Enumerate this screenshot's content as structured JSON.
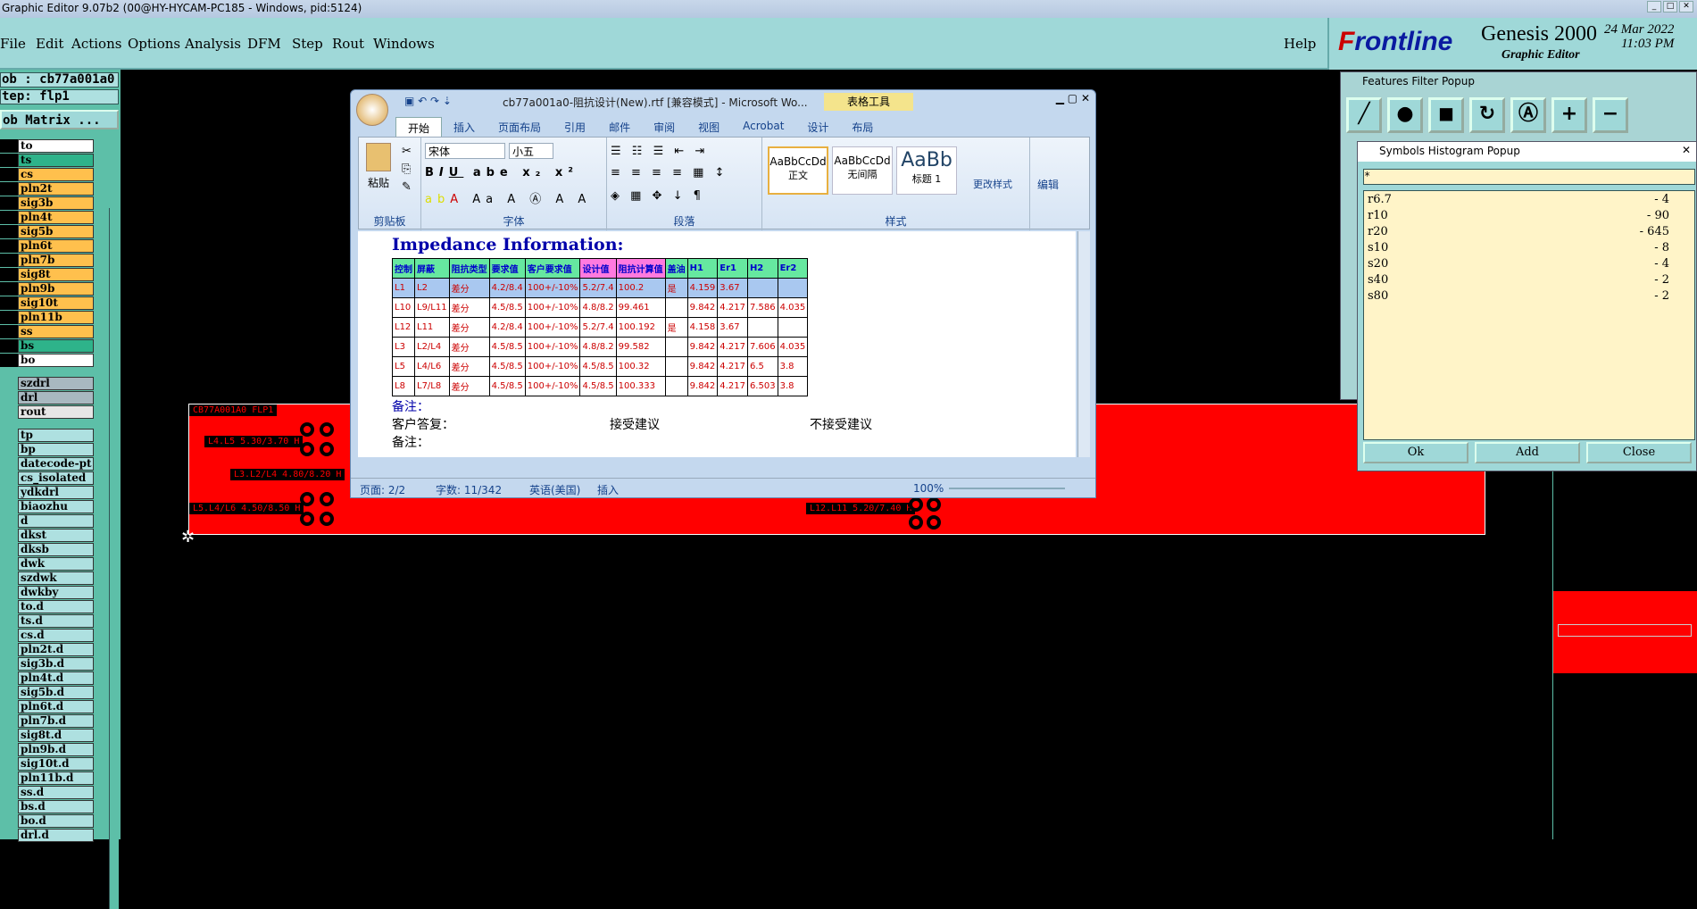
{
  "window_title": "Graphic Editor 9.07b2 (00@HY-HYCAM-PC185 - Windows, pid:5124)",
  "menu": [
    "File",
    "Edit",
    "Actions",
    "Options",
    "Analysis",
    "DFM",
    "Step",
    "Rout",
    "Windows"
  ],
  "help": "Help",
  "brand": {
    "frontline_prefix": "F",
    "frontline_rest": "rontline",
    "genesis": "Genesis 2000",
    "subtitle": "Graphic Editor",
    "date": "24 Mar 2022",
    "time": "11:03 PM"
  },
  "job": {
    "job": "ob : cb77a001a0",
    "step": "tep: flp1",
    "matrix": "ob Matrix ..."
  },
  "layers": [
    {
      "name": "to",
      "color": "#ffffff"
    },
    {
      "name": "ts",
      "color": "#2eb38a"
    },
    {
      "name": "cs",
      "color": "#ffc04d"
    },
    {
      "name": "pln2t",
      "color": "#ffc04d"
    },
    {
      "name": "sig3b",
      "color": "#ffc04d"
    },
    {
      "name": "pln4t",
      "color": "#ffc04d"
    },
    {
      "name": "sig5b",
      "color": "#ffc04d"
    },
    {
      "name": "pln6t",
      "color": "#ffc04d"
    },
    {
      "name": "pln7b",
      "color": "#ffc04d"
    },
    {
      "name": "sig8t",
      "color": "#ffc04d"
    },
    {
      "name": "pln9b",
      "color": "#ffc04d"
    },
    {
      "name": "sig10t",
      "color": "#ffc04d"
    },
    {
      "name": "pln11b",
      "color": "#ffc04d"
    },
    {
      "name": "ss",
      "color": "#ffc04d"
    },
    {
      "name": "bs",
      "color": "#2eb38a"
    },
    {
      "name": "bo",
      "color": "#ffffff"
    }
  ],
  "layers2": [
    {
      "name": "szdrl",
      "color": "#a8b8c0"
    },
    {
      "name": "drl",
      "color": "#a8b8c0"
    },
    {
      "name": "rout",
      "color": "#e6e6e6"
    }
  ],
  "layers3": [
    "tp",
    "bp",
    "datecode-pt",
    "cs_isolated",
    "ydkdrl",
    "biaozhu",
    "d",
    "dkst",
    "dksb",
    "dwk",
    "szdwk",
    "dwkby",
    "to.d",
    "ts.d",
    "cs.d",
    "pln2t.d",
    "sig3b.d",
    "pln4t.d",
    "sig5b.d",
    "pln6t.d",
    "pln7b.d",
    "sig8t.d",
    "pln9b.d",
    "sig10t.d",
    "pln11b.d",
    "ss.d",
    "bs.d",
    "bo.d",
    "drl.d"
  ],
  "board_labels": [
    "CB77A001A0 FLP1",
    "L4.L5 5.30/3.70 H",
    "L3.L2/L4 4.80/8.20 H",
    "L5.L4/L6 4.50/8.50 H",
    "L12.L11 5.20/7.40 H"
  ],
  "word": {
    "title": "cb77a001a0-阻抗设计(New).rtf [兼容模式] - Microsoft Wo...",
    "tools": "表格工具",
    "tabs": [
      "开始",
      "插入",
      "页面布局",
      "引用",
      "邮件",
      "审阅",
      "视图",
      "Acrobat",
      "设计",
      "布局"
    ],
    "font": "宋体",
    "size": "小五",
    "groups": [
      "剪贴板",
      "字体",
      "段落",
      "样式"
    ],
    "paste": "粘贴",
    "styles": [
      {
        "sample": "AaBbCcDd",
        "name": "正文"
      },
      {
        "sample": "AaBbCcDd",
        "name": "无间隔"
      },
      {
        "sample": "AaBb",
        "name": "标题 1"
      }
    ],
    "change_style": "更改样式",
    "edit": "编辑",
    "heading": "Impedance Information:",
    "columns": [
      "控制",
      "屏蔽",
      "阻抗类型",
      "要求值",
      "客户要求值",
      "设计值",
      "阻抗计算值",
      "盖油",
      "H1",
      "Er1",
      "H2",
      "Er2"
    ],
    "rows": [
      [
        "L1",
        "L2",
        "差分",
        "4.2/8.4",
        "100+/-10%",
        "5.2/7.4",
        "100.2",
        "是",
        "4.159",
        "3.67",
        "",
        ""
      ],
      [
        "L10",
        "L9/L11",
        "差分",
        "4.5/8.5",
        "100+/-10%",
        "4.8/8.2",
        "99.461",
        "",
        "9.842",
        "4.217",
        "7.586",
        "4.035"
      ],
      [
        "L12",
        "L11",
        "差分",
        "4.2/8.4",
        "100+/-10%",
        "5.2/7.4",
        "100.192",
        "是",
        "4.158",
        "3.67",
        "",
        ""
      ],
      [
        "L3",
        "L2/L4",
        "差分",
        "4.5/8.5",
        "100+/-10%",
        "4.8/8.2",
        "99.582",
        "",
        "9.842",
        "4.217",
        "7.606",
        "4.035"
      ],
      [
        "L5",
        "L4/L6",
        "差分",
        "4.5/8.5",
        "100+/-10%",
        "4.5/8.5",
        "100.32",
        "",
        "9.842",
        "4.217",
        "6.5",
        "3.8"
      ],
      [
        "L8",
        "L7/L8",
        "差分",
        "4.5/8.5",
        "100+/-10%",
        "4.5/8.5",
        "100.333",
        "",
        "9.842",
        "4.217",
        "6.503",
        "3.8"
      ]
    ],
    "remark1": "备注：",
    "reply": "客户答复：",
    "accept": "接受建议",
    "reject": "不接受建议",
    "remark2": "备注：",
    "status": {
      "page": "页面: 2/2",
      "words": "字数: 11/342",
      "lang": "英语(美国)",
      "mode": "插入",
      "zoom": "100%"
    }
  },
  "ffpopup": {
    "title": "Features Filter Popup"
  },
  "symbols": {
    "title": "Symbols Histogram Popup",
    "filter": "*",
    "rows": [
      {
        "sym": "r6.7",
        "count": "- 4"
      },
      {
        "sym": "r10",
        "count": "- 90"
      },
      {
        "sym": "r20",
        "count": "- 645"
      },
      {
        "sym": "s10",
        "count": "- 8"
      },
      {
        "sym": "s20",
        "count": "- 4"
      },
      {
        "sym": "s40",
        "count": "- 2"
      },
      {
        "sym": "s80",
        "count": "- 2"
      }
    ],
    "ok": "Ok",
    "add": "Add",
    "close": "Close"
  }
}
